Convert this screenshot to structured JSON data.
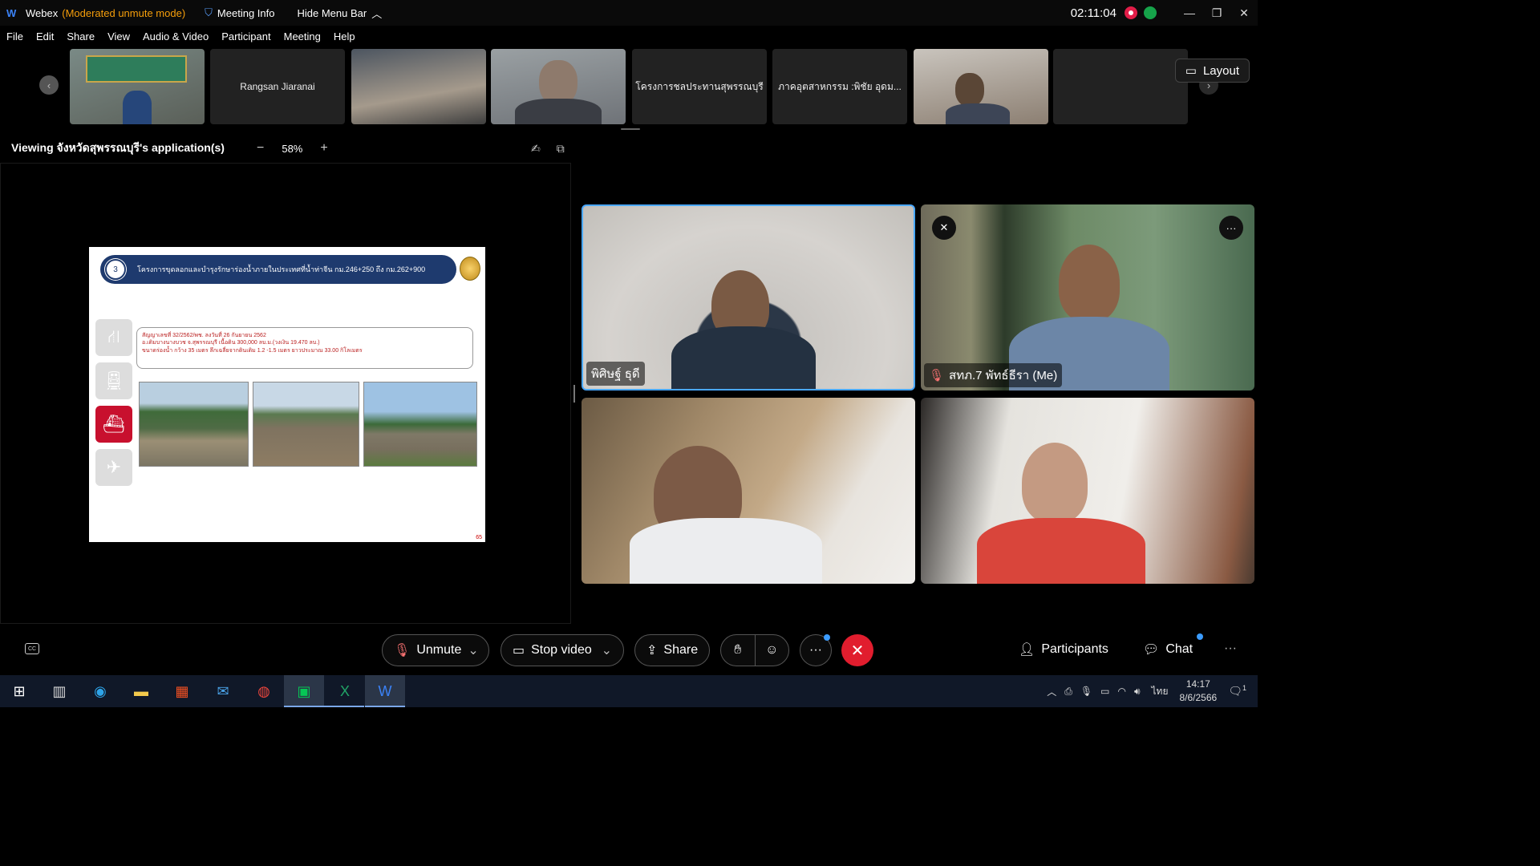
{
  "titlebar": {
    "app": "Webex",
    "mode": "(Moderated unmute mode)",
    "meeting_info": "Meeting Info",
    "hide_menu": "Hide Menu Bar",
    "time": "02:11:04",
    "accent_mode_color": "#f59e0b"
  },
  "menu": [
    "File",
    "Edit",
    "Share",
    "View",
    "Audio & Video",
    "Participant",
    "Meeting",
    "Help"
  ],
  "filmstrip": {
    "tiles": [
      {
        "label": "",
        "video": true
      },
      {
        "label": "Rangsan Jiaranai",
        "video": false
      },
      {
        "label": "",
        "video": true
      },
      {
        "label": "",
        "video": true
      },
      {
        "label": "โครงการชลประทานสุพรรณบุรี",
        "video": false
      },
      {
        "label": "ภาคอุตสาหกรรม :พิชัย อุดม...",
        "video": false
      },
      {
        "label": "",
        "video": true
      },
      {
        "label": "",
        "video": false
      }
    ],
    "layout_label": "Layout"
  },
  "viewing": {
    "title": "Viewing จังหวัดสุพรรณบุรี's application(s)",
    "zoom": "58%"
  },
  "slide": {
    "number": "3",
    "header": "โครงการขุดลอกและบำรุงรักษาร่องน้ำภายในประเทศที่น้ำท่าจีน กม.246+250 ถึง กม.262+900",
    "line1": "สัญญาเลขที่ 32/2562/พช. ลงวันที่ 26 กันยายน 2562",
    "line2": "อ.เดิมบางนางบวช จ.สุพรรณบุรี เนื้อดิน 300,000 ลบ.ม.(วงเงิน 19.470 ลบ.)",
    "line3": "ขนาดร่องน้ำ กว้าง 35 เมตร ลึกเฉลี่ยจากดินเดิม 1.2 -1.5 เมตร ยาวประมาณ 33.00 กิโลเมตร",
    "page": "65"
  },
  "videos": [
    {
      "name": "พิศิษฐ์ ธุดี",
      "muted": false,
      "active": true
    },
    {
      "name": "สทภ.7 พัทธ์ธีรา (Me)",
      "muted": true,
      "active": false
    },
    {
      "name": "",
      "muted": false,
      "active": false
    },
    {
      "name": "",
      "muted": false,
      "active": false
    }
  ],
  "controls": {
    "unmute": "Unmute",
    "stop_video": "Stop video",
    "share": "Share",
    "participants": "Participants",
    "chat": "Chat",
    "end_color": "#e11d2e"
  },
  "taskbar": {
    "lang": "ไทย",
    "time": "14:17",
    "date": "8/6/2566",
    "notif": "1"
  }
}
